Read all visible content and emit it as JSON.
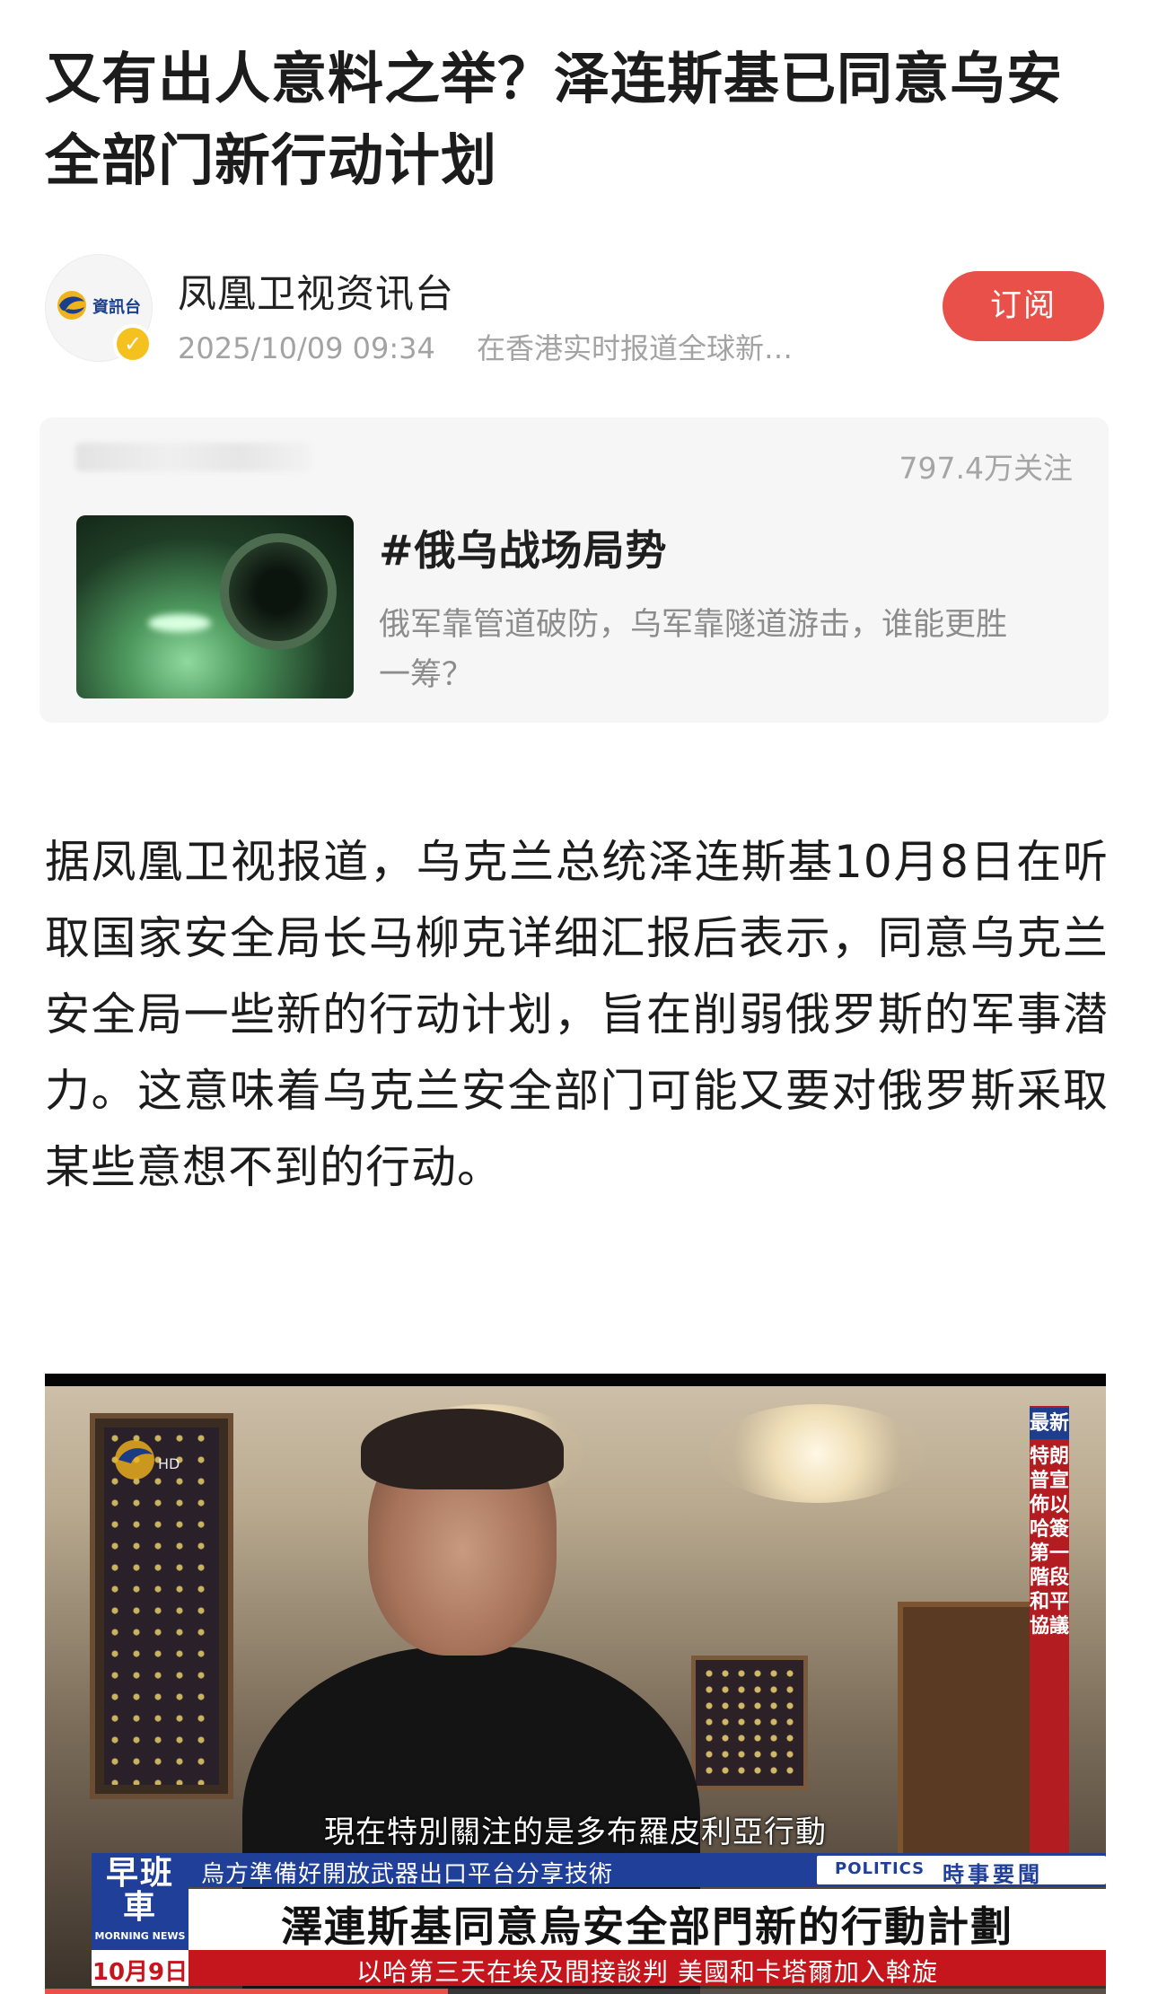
{
  "article": {
    "title": "又有出人意料之举？泽连斯基已同意乌安全部门新行动计划"
  },
  "author": {
    "name": "凤凰卫视资讯台",
    "avatar_text": "資訊台",
    "date": "2025/10/09 09:34",
    "bio": "在香港实时报道全球新…",
    "subscribe_label": "订阅",
    "verified_icon": "verified-badge-icon",
    "colors": {
      "subscribe": "#e9504a",
      "verified": "#f4c11f"
    }
  },
  "topic": {
    "followers": "797.4万关注",
    "title": "#俄乌战场局势",
    "description": "俄军靠管道破防，乌军靠隧道游击，谁能更胜一筹？"
  },
  "body": {
    "paragraph": "据凤凰卫视报道，乌克兰总统泽连斯基10月8日在听取国家安全局长马柳克详细汇报后表示，同意乌克兰安全局一些新的行动计划，旨在削弱俄罗斯的军事潜力。这意味着乌克兰安全部门可能又要对俄罗斯采取某些意想不到的行动。"
  },
  "video": {
    "side_banner_head": "最新",
    "side_banner": "特朗普宣佈以哈簽第一階段和平協議",
    "subtitle": "現在特別關注的是多布羅皮利亞行動",
    "ticker_top": "烏方準備好開放武器出口平台分享技術",
    "section_en": "POLITICS",
    "section_zh": "時事要聞",
    "headline": "澤連斯基同意烏安全部門新的行動計劃",
    "ticker_bottom": "以哈第三天在埃及間接談判  美國和卡塔爾加入斡旋",
    "show_name": "早班車",
    "show_name_en": "MORNING NEWS",
    "date": "10月9日",
    "watermark_text": "HD",
    "progress": 0.38,
    "colors": {
      "banner_red": "#c4161c",
      "banner_blue": "#1f3f98"
    }
  }
}
